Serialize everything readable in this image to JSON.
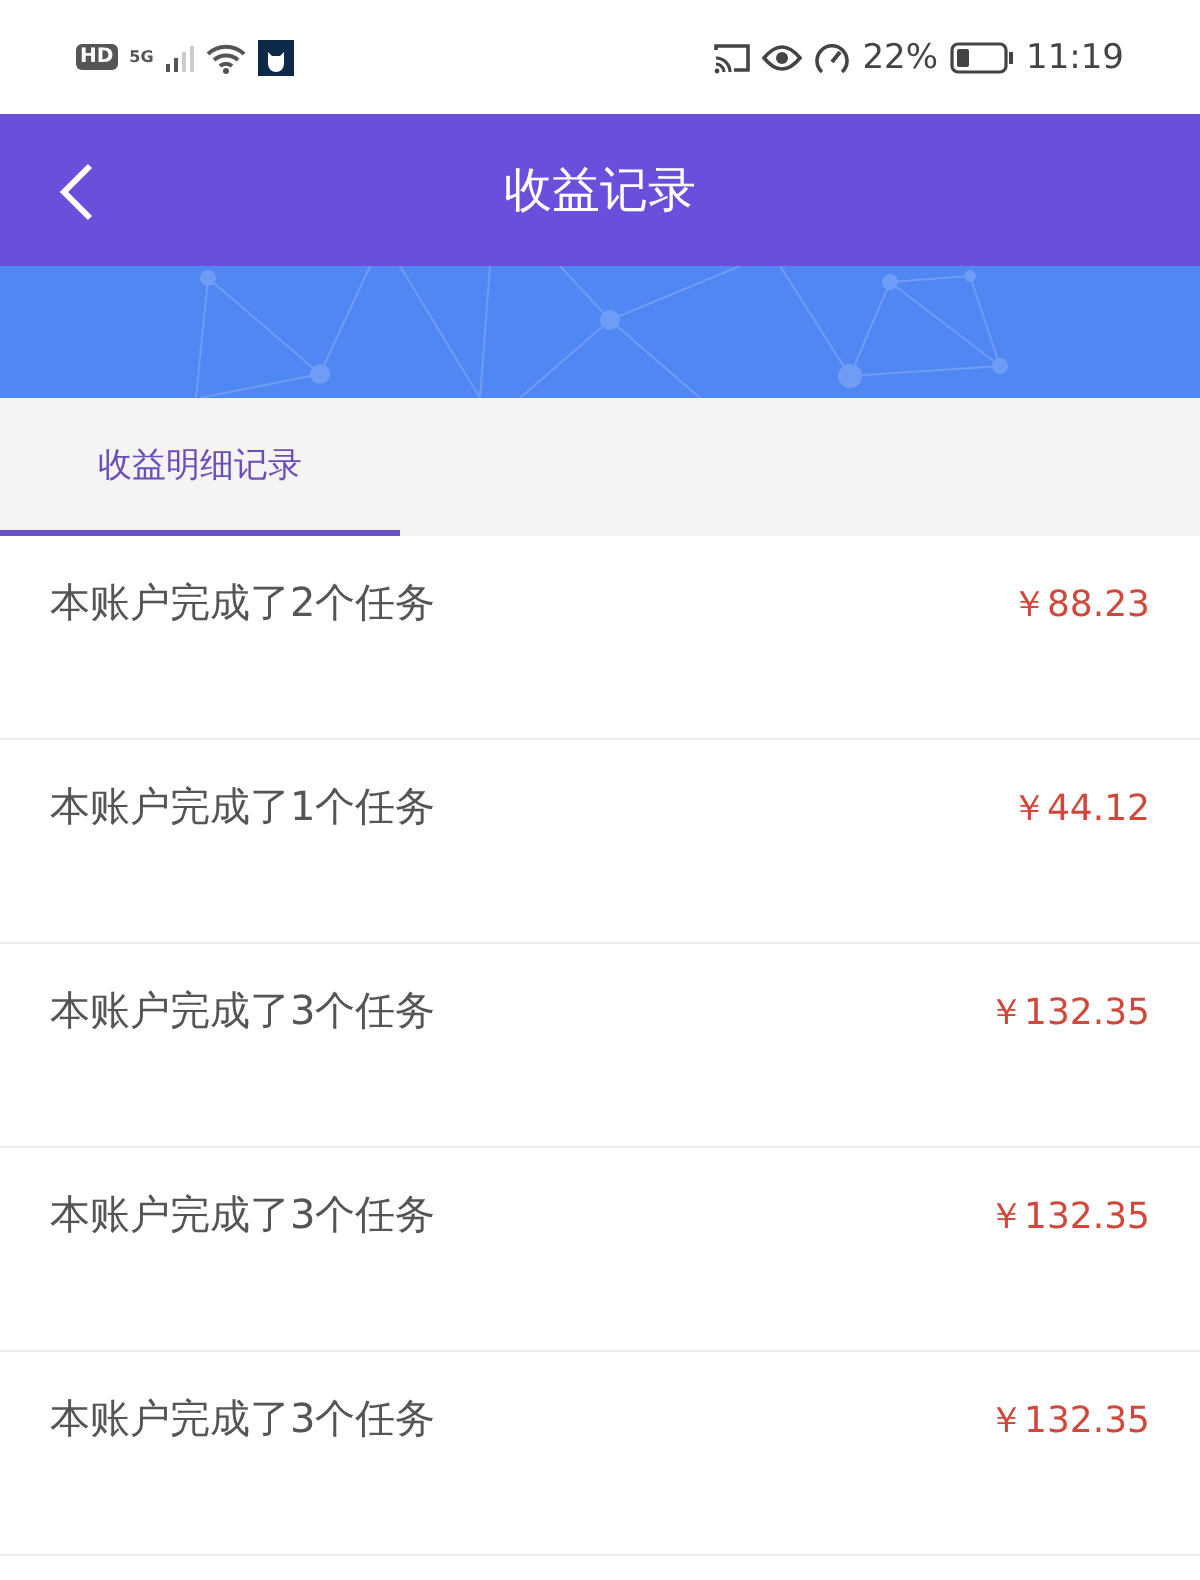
{
  "status_bar": {
    "hd": "HD",
    "network": "5G",
    "battery": "22%",
    "time": "11:19"
  },
  "header": {
    "title": "收益记录"
  },
  "tabs": [
    {
      "label": "收益明细记录",
      "selected": true
    }
  ],
  "records": [
    {
      "text": "本账户完成了2个任务",
      "amount": "￥88.23"
    },
    {
      "text": "本账户完成了1个任务",
      "amount": "￥44.12"
    },
    {
      "text": "本账户完成了3个任务",
      "amount": "￥132.35"
    },
    {
      "text": "本账户完成了3个任务",
      "amount": "￥132.35"
    },
    {
      "text": "本账户完成了3个任务",
      "amount": "￥132.35"
    }
  ]
}
